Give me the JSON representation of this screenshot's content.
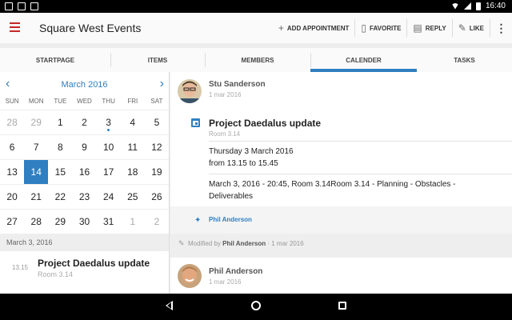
{
  "status_bar": {
    "time": "16:40"
  },
  "app": {
    "title": "Square West Events"
  },
  "actions": [
    {
      "icon": "plus-icon",
      "label": "ADD APPOINTMENT"
    },
    {
      "icon": "bookmark-icon",
      "label": "FAVORITE"
    },
    {
      "icon": "reply-icon",
      "label": "REPLY"
    },
    {
      "icon": "thumbs-up-icon",
      "label": "LIKE"
    }
  ],
  "tabs": [
    {
      "label": "STARTPAGE",
      "active": false
    },
    {
      "label": "ITEMS",
      "active": false
    },
    {
      "label": "MEMBERS",
      "active": false
    },
    {
      "label": "CALENDER",
      "active": true
    },
    {
      "label": "TASKS",
      "active": false
    }
  ],
  "calendar": {
    "month_label": "March 2016",
    "days_of_week": [
      "SUN",
      "MON",
      "TUE",
      "WED",
      "THU",
      "FRI",
      "SAT"
    ],
    "weeks": [
      [
        {
          "d": "28",
          "muted": true
        },
        {
          "d": "29",
          "muted": true
        },
        {
          "d": "1"
        },
        {
          "d": "2"
        },
        {
          "d": "3",
          "event": true
        },
        {
          "d": "4"
        },
        {
          "d": "5"
        }
      ],
      [
        {
          "d": "6"
        },
        {
          "d": "7"
        },
        {
          "d": "8"
        },
        {
          "d": "9"
        },
        {
          "d": "10"
        },
        {
          "d": "11"
        },
        {
          "d": "12"
        }
      ],
      [
        {
          "d": "13"
        },
        {
          "d": "14",
          "selected": true
        },
        {
          "d": "15"
        },
        {
          "d": "16"
        },
        {
          "d": "17"
        },
        {
          "d": "18"
        },
        {
          "d": "19"
        }
      ],
      [
        {
          "d": "20"
        },
        {
          "d": "21"
        },
        {
          "d": "22"
        },
        {
          "d": "23"
        },
        {
          "d": "24"
        },
        {
          "d": "25"
        },
        {
          "d": "26"
        }
      ],
      [
        {
          "d": "27"
        },
        {
          "d": "28"
        },
        {
          "d": "29"
        },
        {
          "d": "30"
        },
        {
          "d": "31"
        },
        {
          "d": "1",
          "muted": true
        },
        {
          "d": "2",
          "muted": true
        }
      ]
    ]
  },
  "agenda": {
    "date_header": "March 3, 2016",
    "event": {
      "time": "13.15",
      "title": "Project Daedalus update",
      "room": "Room 3.14"
    }
  },
  "post": {
    "author": "Stu Sanderson",
    "date": "1 mar 2016",
    "update": {
      "title": "Project Daedalus update",
      "room": "Room 3.14",
      "when_line1": "Thursday 3 March 2016",
      "when_line2": "from 13.15 to 15.45",
      "details_line1": "March 3, 2016 - 20:45, Room 3.14Room 3.14 - Planning - Obstacles -",
      "details_line2": "Deliverables"
    },
    "liked_by": "Phil Anderson",
    "modified_prefix": "Modified by",
    "modified_by": "Phil Anderson",
    "modified_date": "1 mar 2016"
  },
  "reply": {
    "author": "Phil Anderson",
    "date": "1 mar 2016"
  },
  "colors": {
    "accent": "#2f7fc1",
    "menu": "#c62828"
  }
}
